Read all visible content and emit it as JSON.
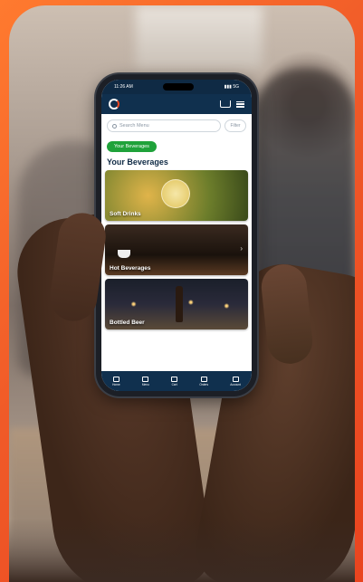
{
  "status_bar": {
    "time": "11:26 AM",
    "indicators": "▮▮▮ 5G"
  },
  "app": {
    "logo": "app-logo-icon"
  },
  "search": {
    "placeholder": "Search Menu",
    "filter_label": "Filter"
  },
  "filter_chip": {
    "label": "Your Beverages"
  },
  "section": {
    "heading": "Your Beverages"
  },
  "categories": [
    {
      "label": "Soft Drinks"
    },
    {
      "label": "Hot Beverages"
    },
    {
      "label": "Bottled Beer"
    }
  ],
  "tabs": [
    {
      "label": "Home"
    },
    {
      "label": "Menu"
    },
    {
      "label": "Cart"
    },
    {
      "label": "Orders"
    },
    {
      "label": "Account"
    }
  ],
  "colors": {
    "accent": "#e9441f",
    "navy": "#10304e",
    "green": "#1fa23a"
  }
}
